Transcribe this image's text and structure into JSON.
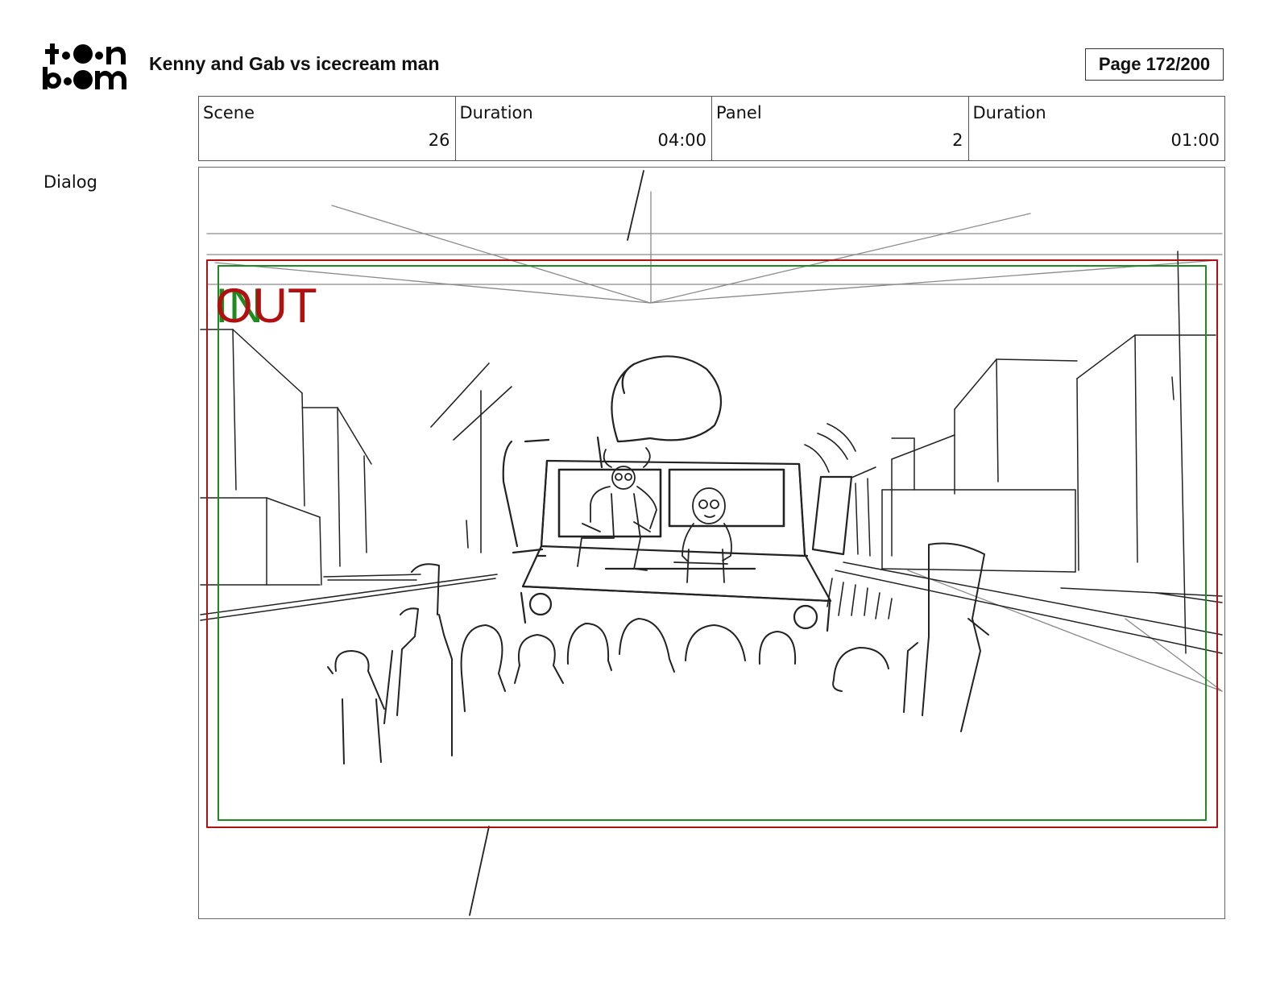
{
  "header": {
    "logo_text_top": "toon",
    "logo_text_bottom": "boom",
    "project_title": "Kenny and Gab vs icecream man",
    "page": "Page 172/200"
  },
  "info": {
    "scene_label": "Scene",
    "scene_value": "26",
    "scene_duration_label": "Duration",
    "scene_duration_value": "04:00",
    "panel_label": "Panel",
    "panel_value": "2",
    "panel_duration_label": "Duration",
    "panel_duration_value": "01:00"
  },
  "dialog": {
    "label": "Dialog"
  },
  "panel_image": {
    "out_label": "OUT",
    "in_label": "IN",
    "out_color": "#b01010",
    "in_color": "#1f8a1f"
  }
}
